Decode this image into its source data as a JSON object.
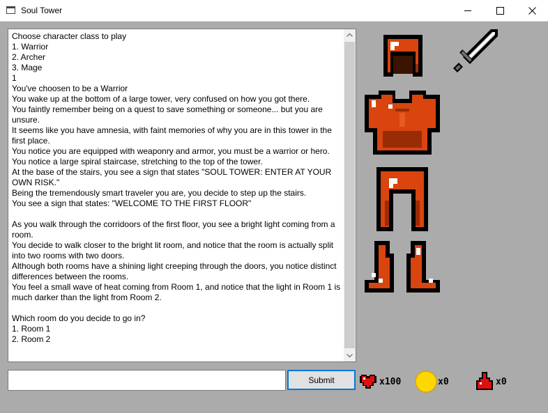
{
  "window": {
    "title": "Soul Tower"
  },
  "console": {
    "lines": [
      "Choose character class to play",
      "1. Warrior",
      "2. Archer",
      "3. Mage",
      "1",
      "You've choosen to be a Warrior",
      "You wake up at the bottom of a large tower, very confused on how you got there.",
      "You faintly remember being on a quest to save something or someone... but you are unsure.",
      "It seems like you have amnesia, with faint memories of why you are in this tower in the first place.",
      "You notice you are equipped with weaponry and armor, you must be a warrior or hero.",
      "You notice a large spiral staircase, stretching to the top of the tower.",
      "At the base of the stairs, you see a sign that states \"SOUL TOWER: ENTER AT YOUR OWN RISK.\"",
      "Being the tremendously smart traveler you are, you decide to step up the stairs.",
      "You see a sign that states: \"WELCOME TO THE FIRST FLOOR\"",
      "",
      "As you walk through the corridoors of the first floor, you see a bright light coming from a room.",
      "You decide to walk closer to the bright lit room, and notice that the room is actually split into two rooms with two doors.",
      "Although both rooms have a shining light creeping through the doors, you notice distinct differences between the rooms.",
      "You feel a small wave of heat coming from Room 1, and notice that the light in Room 1 is much darker than the light from Room 2.",
      "",
      "Which room do you decide to go in?",
      "1. Room 1",
      "2. Room 2"
    ]
  },
  "input": {
    "value": "",
    "placeholder": ""
  },
  "submit": {
    "label": "Submit"
  },
  "stats": {
    "health": "x100",
    "gold": "x0",
    "potions": "x0"
  },
  "equipment": {
    "helmet": "helmet-icon",
    "weapon": "sword-icon",
    "chest": "chestplate-icon",
    "legs": "leggings-icon",
    "boots": "boots-icon"
  },
  "colors": {
    "armor": "#d9440f",
    "armor_dark": "#9a2c05",
    "outline": "#000000",
    "heart": "#e01010",
    "coin": "#ffd700",
    "potion": "#e01010"
  }
}
